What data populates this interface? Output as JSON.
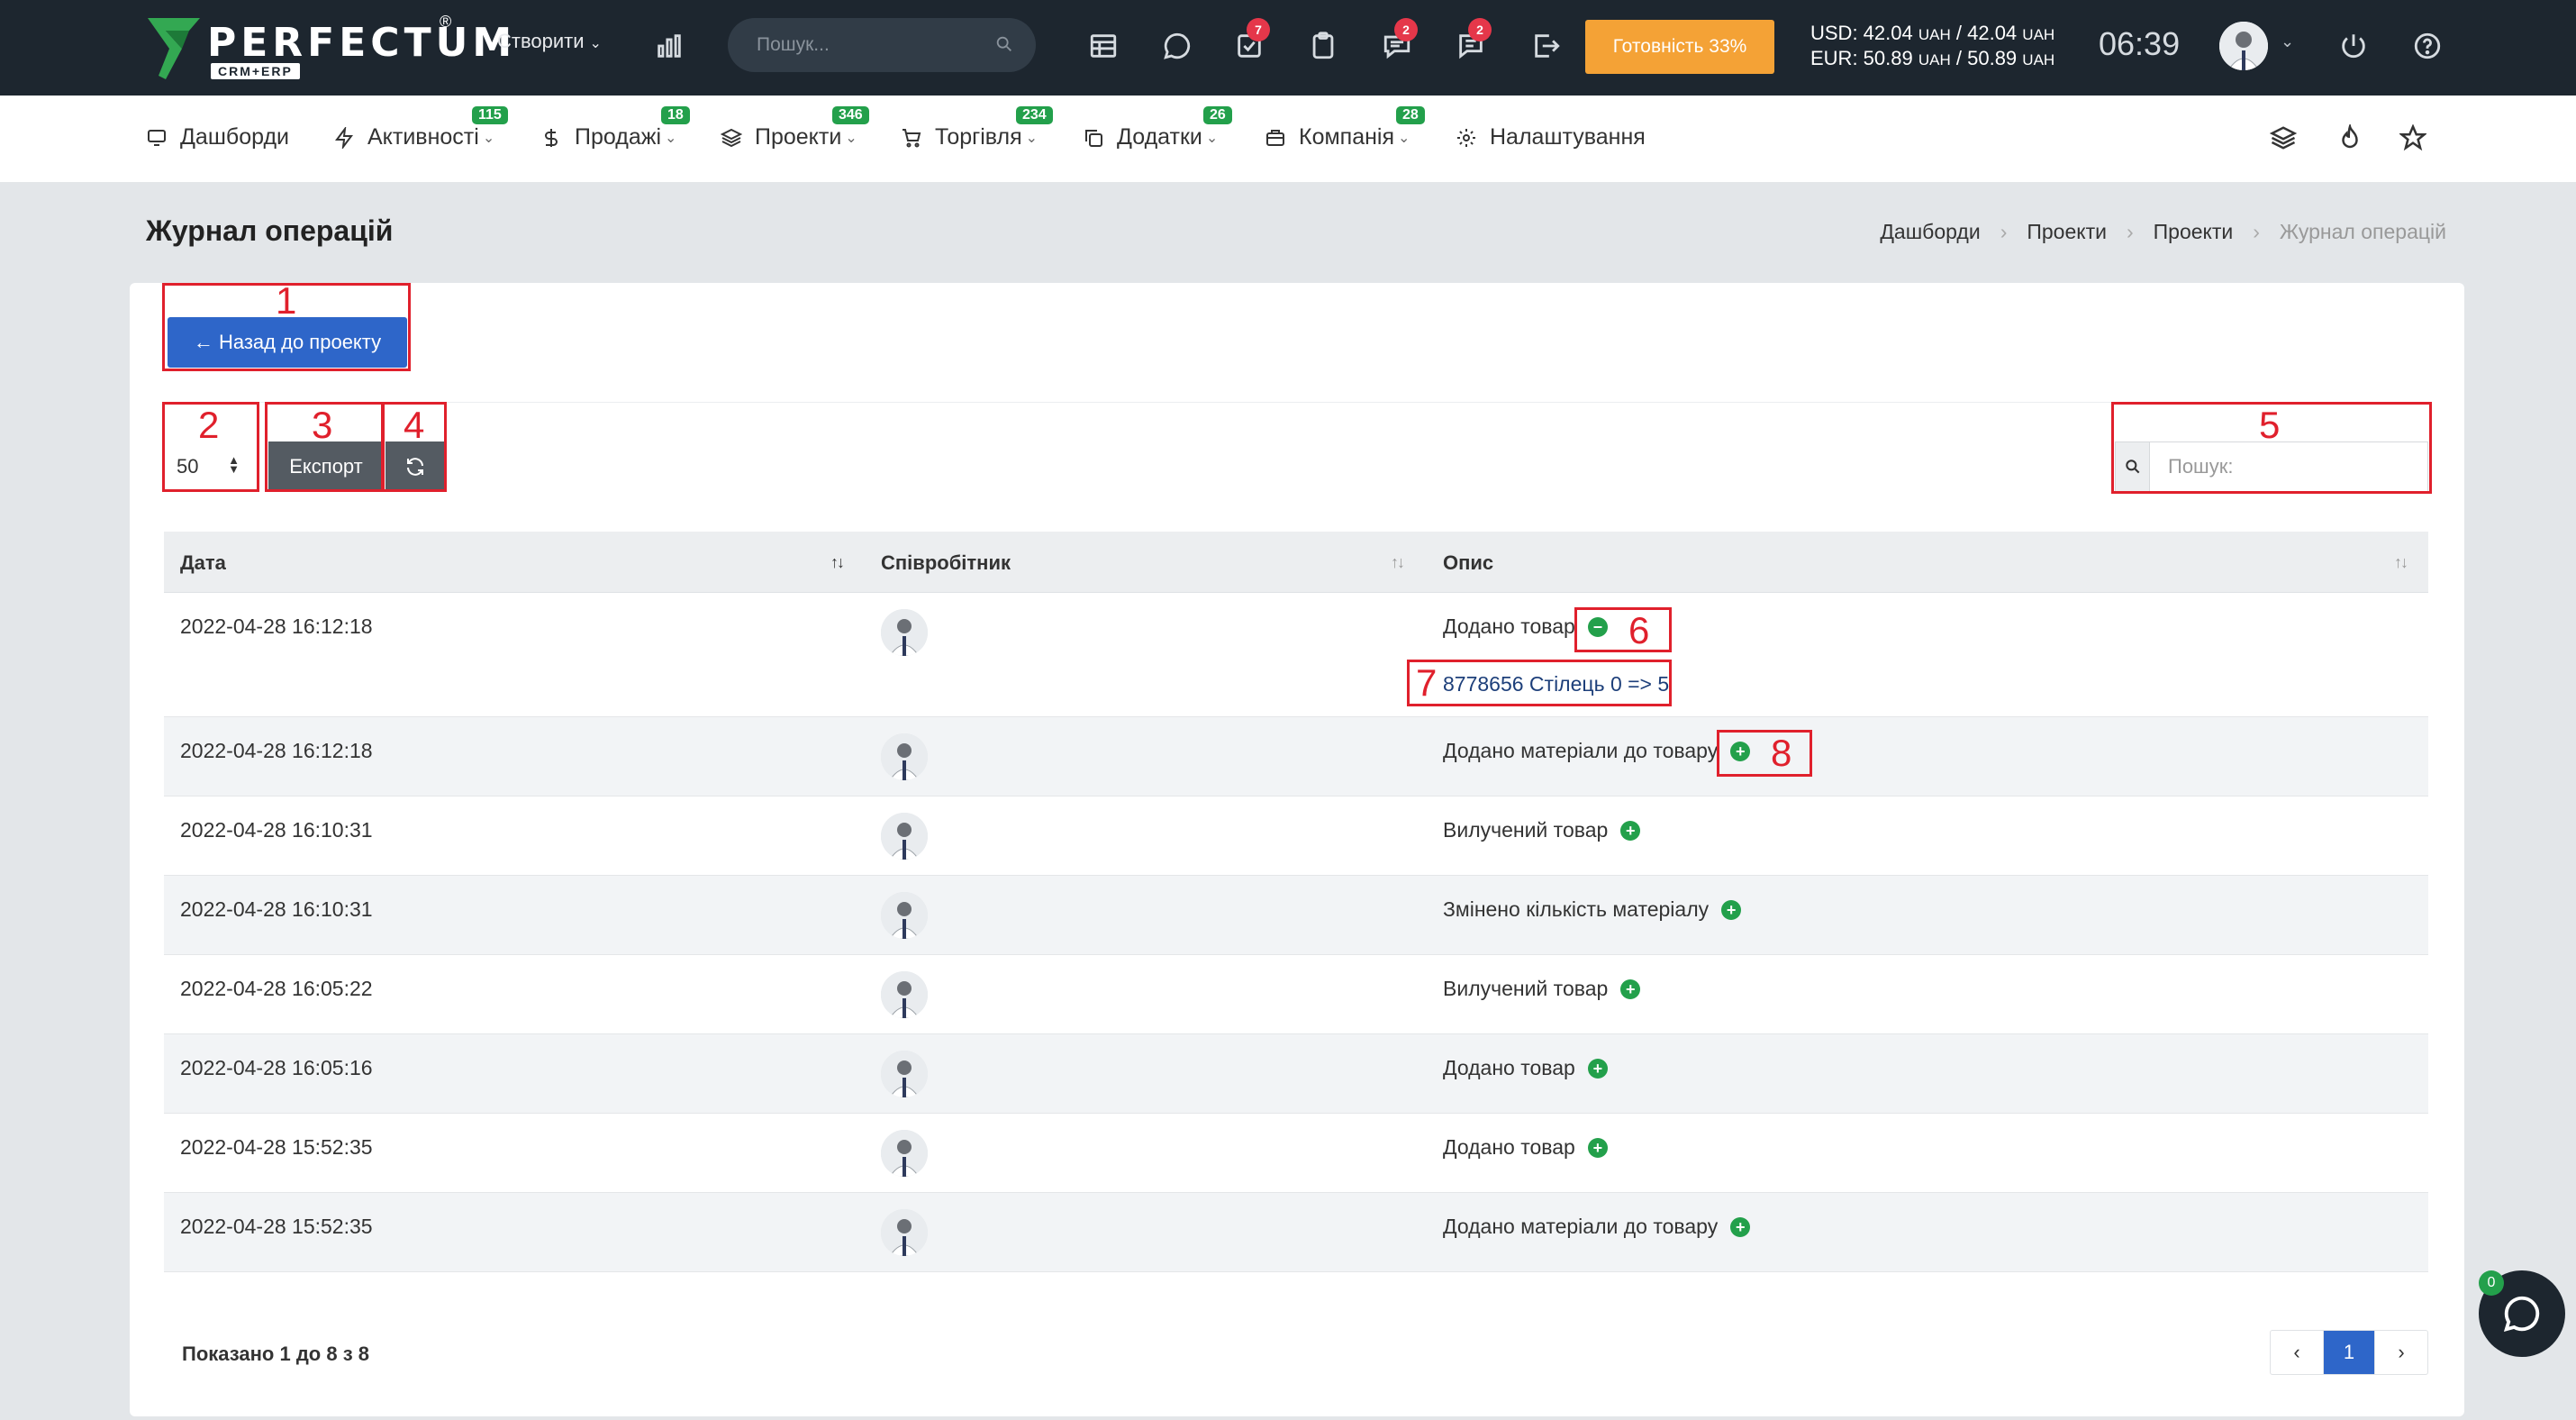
{
  "app": {
    "logo_text": "PERFECTUM",
    "logo_registered": "®",
    "logo_sub": "CRM+ERP"
  },
  "topbar": {
    "create_label": "Створити",
    "search_placeholder": "Пошук...",
    "icons": [
      "bar-chart-icon",
      "calendar-icon",
      "chat-icon",
      "tasks-icon",
      "clipboard-icon",
      "messages-icon",
      "comments-icon",
      "logout-door-icon"
    ],
    "badges": {
      "tasks": "7",
      "messages": "2",
      "comments": "2"
    },
    "ready_label": "Готовність 33%",
    "rates": {
      "usd_label": "USD: 42.04",
      "usd_unit1": "UAH",
      "usd_sep": "/ 42.04",
      "usd_unit2": "UAH",
      "eur_label": "EUR: 50.89",
      "eur_unit1": "UAH",
      "eur_sep": "/ 50.89",
      "eur_unit2": "UAH"
    },
    "clock": "06:39",
    "accent_color": "#f4a236",
    "bg_color": "#1d262f"
  },
  "nav": {
    "items": [
      {
        "label": "Дашборди",
        "icon": "monitor-icon",
        "badge": ""
      },
      {
        "label": "Активності",
        "icon": "lightning-icon",
        "badge": "115"
      },
      {
        "label": "Продажі",
        "icon": "dollar-icon",
        "badge": "18"
      },
      {
        "label": "Проекти",
        "icon": "layers-icon",
        "badge": "346"
      },
      {
        "label": "Торгівля",
        "icon": "cart-icon",
        "badge": "234"
      },
      {
        "label": "Додатки",
        "icon": "copy-icon",
        "badge": "26"
      },
      {
        "label": "Компанія",
        "icon": "briefcase-icon",
        "badge": "28"
      },
      {
        "label": "Налаштування",
        "icon": "gear-icon",
        "badge": ""
      }
    ],
    "right_icons": [
      "layers-icon",
      "fire-icon",
      "star-icon"
    ]
  },
  "page": {
    "title": "Журнал операцій",
    "breadcrumb": [
      "Дашборди",
      "Проекти",
      "Проекти",
      "Журнал операцій"
    ]
  },
  "toolbar": {
    "back_label": "← Назад до проекту",
    "page_length": "50",
    "export_label": "Експорт",
    "search_placeholder": "Пошук:"
  },
  "table": {
    "columns": [
      "Дата",
      "Співробітник",
      "Опис"
    ],
    "rows": [
      {
        "date": "2022-04-28 16:12:18",
        "desc": "Додано товар",
        "toggle": "−",
        "detail": "8778656 Стілець 0 => 5"
      },
      {
        "date": "2022-04-28 16:12:18",
        "desc": "Додано матеріали до товару",
        "toggle": "+"
      },
      {
        "date": "2022-04-28 16:10:31",
        "desc": "Вилучений товар",
        "toggle": "+"
      },
      {
        "date": "2022-04-28 16:10:31",
        "desc": "Змінено кількість матеріалу",
        "toggle": "+"
      },
      {
        "date": "2022-04-28 16:05:22",
        "desc": "Вилучений товар",
        "toggle": "+"
      },
      {
        "date": "2022-04-28 16:05:16",
        "desc": "Додано товар",
        "toggle": "+"
      },
      {
        "date": "2022-04-28 15:52:35",
        "desc": "Додано товар",
        "toggle": "+"
      },
      {
        "date": "2022-04-28 15:52:35",
        "desc": "Додано матеріали до товару",
        "toggle": "+"
      }
    ]
  },
  "footer": {
    "info": "Показано 1 до 8 з 8",
    "pager_prev": "‹",
    "pager_current": "1",
    "pager_next": "›",
    "chat_badge": "0"
  },
  "annotations": [
    "1",
    "2",
    "3",
    "4",
    "5",
    "6",
    "7",
    "8"
  ]
}
